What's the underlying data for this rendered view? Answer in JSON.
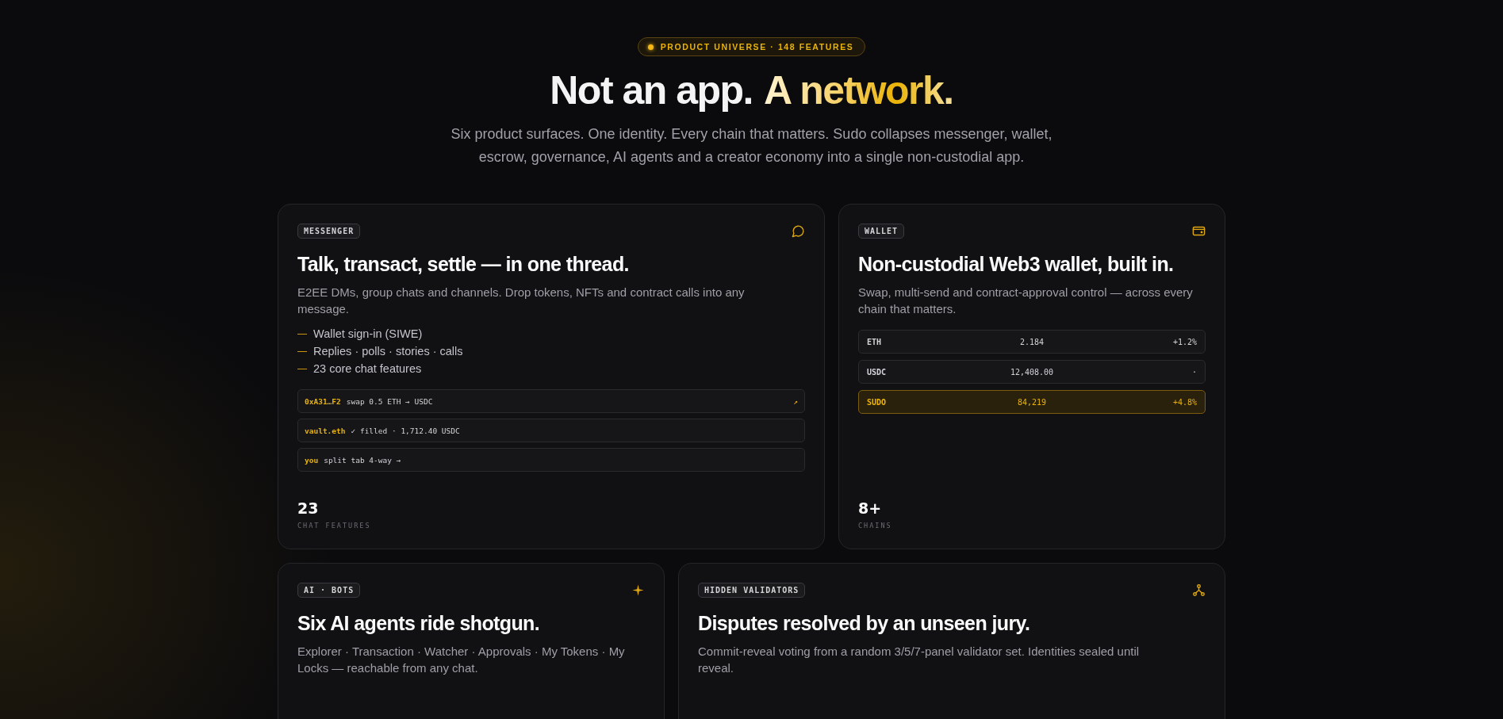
{
  "hero": {
    "badge": "PRODUCT UNIVERSE · 148 FEATURES",
    "title": "Not an app.",
    "title_accent": "A network.",
    "subtitle": "Six product surfaces. One identity. Every chain that matters. Sudo collapses messenger, wallet, escrow, governance, AI agents and a creator economy into a single non-custodial app."
  },
  "rows": [
    {
      "cards": [
        {
          "kind": "messenger",
          "tag": "MESSENGER",
          "title": "Talk, transact, settle — in one thread.",
          "description": "E2EE DMs, group chats and channels. Drop tokens, NFTs and contract calls into any message.",
          "bullets": [
            "Wallet sign-in (SIWE)",
            "Replies · polls · stories · calls",
            "23 core chat features"
          ],
          "messages": [
            {
              "sender": "0xA31…F2",
              "text": "swap 0.5 ETH → USDC",
              "action": "↗"
            },
            {
              "sender": "vault.eth",
              "text": "✓ filled · 1,712.40 USDC"
            },
            {
              "sender": "you",
              "text": "split tab 4-way →"
            }
          ],
          "stat": {
            "value": "23",
            "label": "CHAT FEATURES"
          }
        },
        {
          "kind": "wallet",
          "tag": "WALLET",
          "title": "Non-custodial Web3 wallet, built in.",
          "description": "Swap, multi-send and contract-approval control — across every chain that matters.",
          "assets": [
            {
              "symbol": "ETH",
              "amount": "2.184",
              "change": "+1.2%",
              "selected": false
            },
            {
              "symbol": "USDC",
              "amount": "12,408.00",
              "change": "·",
              "selected": false
            },
            {
              "symbol": "SUDO",
              "amount": "84,219",
              "change": "+4.8%",
              "selected": true
            }
          ],
          "stat": {
            "value": "8+",
            "label": "CHAINS"
          }
        }
      ]
    },
    {
      "cards": [
        {
          "kind": "bots",
          "tag": "AI · BOTS",
          "title": "Six AI agents ride shotgun.",
          "description": "Explorer · Transaction · Watcher · Approvals · My Tokens · My Locks — reachable from any chat."
        },
        {
          "kind": "validators",
          "tag": "HIDDEN VALIDATORS",
          "title": "Disputes resolved by an unseen jury.",
          "description": "Commit-reveal voting from a random 3/5/7-panel validator set. Identities sealed until reveal."
        }
      ]
    }
  ]
}
